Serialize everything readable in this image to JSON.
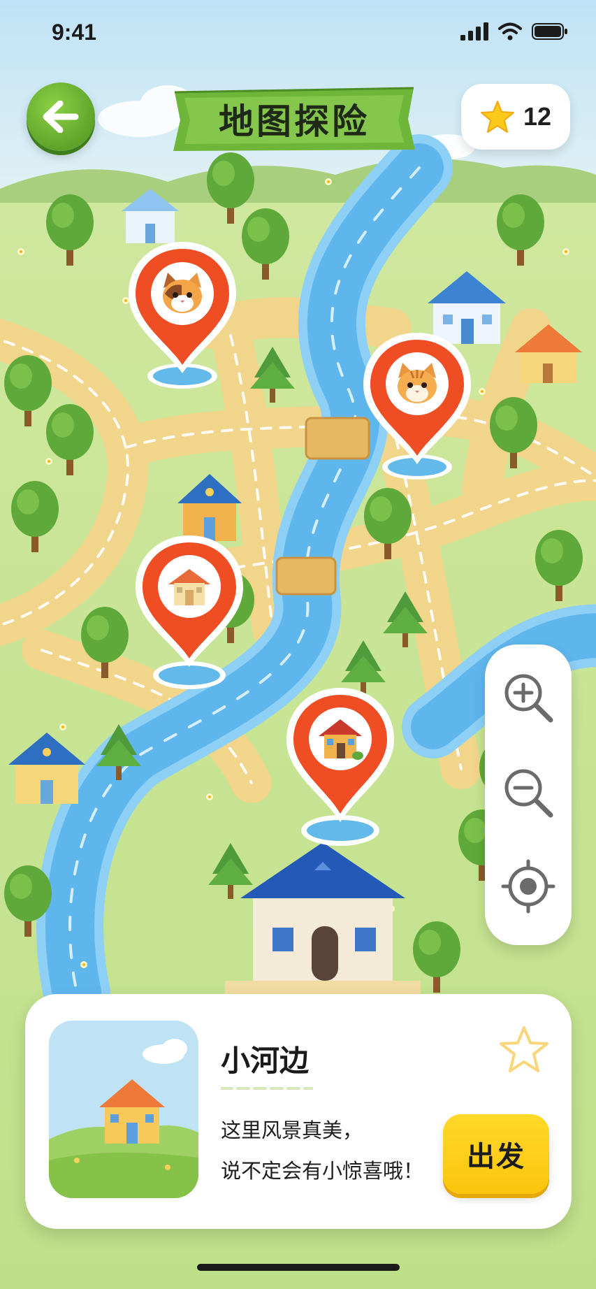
{
  "status_bar": {
    "time": "9:41"
  },
  "header": {
    "title": "地图探险",
    "star_count": "12",
    "back_icon": "arrow-left-icon"
  },
  "pins": [
    {
      "kind": "cat",
      "icon": "cat-face-icon"
    },
    {
      "kind": "cat",
      "icon": "cat-face-icon"
    },
    {
      "kind": "house",
      "icon": "house-icon"
    },
    {
      "kind": "house",
      "icon": "house-icon"
    }
  ],
  "zoom_controls": {
    "zoom_in_icon": "zoom-in-icon",
    "zoom_out_icon": "zoom-out-icon",
    "locate_icon": "locate-icon"
  },
  "card": {
    "title": "小河边",
    "description_line1": "这里风景真美，",
    "description_line2": "说不定会有小惊喜哦！",
    "go_label": "出发",
    "favorite_icon": "star-outline-icon"
  },
  "colors": {
    "accent_green": "#6cb531",
    "pin_red": "#f2512a",
    "go_yellow": "#fcd01c",
    "river_blue": "#5fb6ec",
    "road_yellow": "#f5d98a",
    "grass": "#c9e497"
  }
}
